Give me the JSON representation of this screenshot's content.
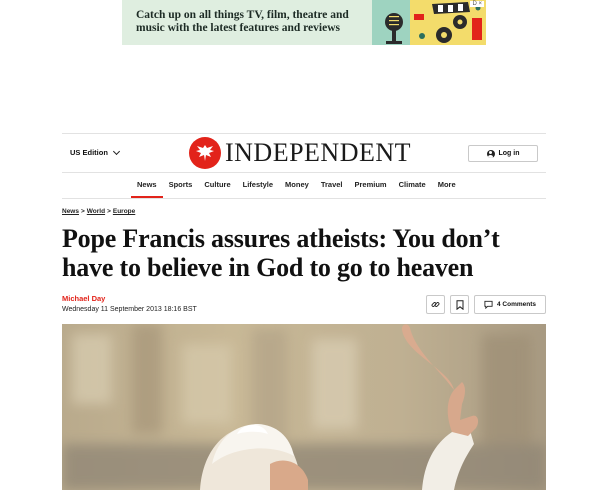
{
  "ad": {
    "text": "Catch up on all things TV, film, theatre and music with the latest features and reviews",
    "choice_label": "D ×"
  },
  "header": {
    "edition_label": "US Edition",
    "logo_text": "INDEPENDENT",
    "login_label": "Log in"
  },
  "nav": {
    "items": [
      {
        "label": "News"
      },
      {
        "label": "Sports"
      },
      {
        "label": "Culture"
      },
      {
        "label": "Lifestyle"
      },
      {
        "label": "Money"
      },
      {
        "label": "Travel"
      },
      {
        "label": "Premium"
      },
      {
        "label": "Climate"
      },
      {
        "label": "More"
      }
    ],
    "active": "News"
  },
  "breadcrumb": {
    "items": [
      {
        "label": "News"
      },
      {
        "label": "World"
      },
      {
        "label": "Europe"
      }
    ],
    "separator": ">"
  },
  "article": {
    "headline": "Pope Francis assures atheists: You don’t have to believe in God to go to heaven",
    "author": "Michael Day",
    "date": "Wednesday 11 September 2013 18:16 BST",
    "comments_label": "4 Comments"
  },
  "colors": {
    "brand_red": "#e2231a",
    "ad_background": "#dfeee0"
  },
  "icons": {
    "link": "link-icon",
    "bookmark": "bookmark-icon",
    "comment": "comment-icon",
    "user": "user-icon",
    "chevron": "chevron-down-icon",
    "logo": "eagle-logo-icon"
  }
}
